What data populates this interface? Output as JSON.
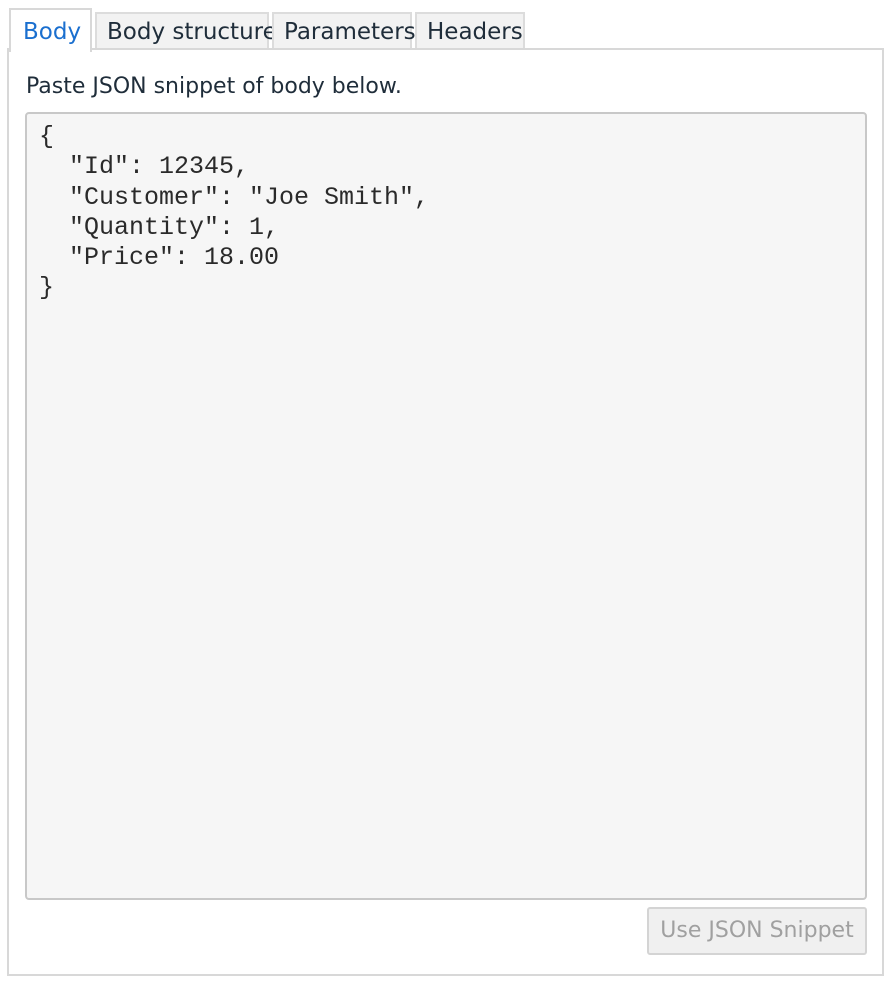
{
  "tabs": {
    "body": "Body",
    "body_structure": "Body structure",
    "parameters": "Parameters",
    "headers": "Headers",
    "active": "Body"
  },
  "panel": {
    "instructions": "Paste JSON snippet of body below.",
    "snippet": "{\n  \"Id\": 12345,\n  \"Customer\": \"Joe Smith\",\n  \"Quantity\": 1,\n  \"Price\": 18.00\n}",
    "use_button_label": "Use JSON Snippet",
    "use_button_enabled": false
  },
  "colors": {
    "active_tab_text": "#1a6fcf",
    "editor_background": "#f6f6f6",
    "disabled_button_text": "#a0a0a0"
  }
}
